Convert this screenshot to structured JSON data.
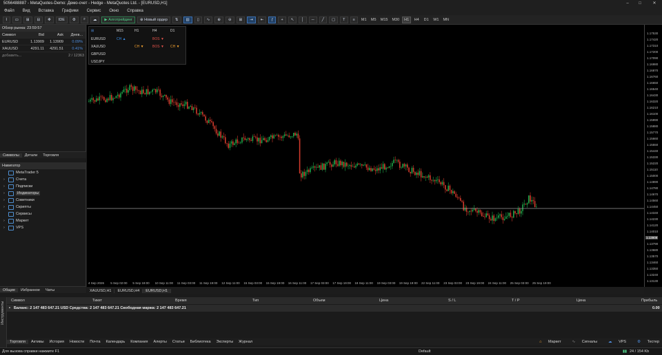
{
  "title": "5056488887 - MetaQuotes-Demo: Демо-счет - Hedge - MetaQuotes Ltd. - [EURUSD,H1]",
  "menu": [
    "Файл",
    "Вид",
    "Вставка",
    "Графики",
    "Сервис",
    "Окно",
    "Справка"
  ],
  "toolbar": {
    "algo": "Алготрейдинг",
    "new_order": "Новый ордер",
    "ide": "IDE"
  },
  "timeframes": [
    "M1",
    "M5",
    "M15",
    "M30",
    "H1",
    "H4",
    "D1",
    "W1",
    "MN"
  ],
  "market_watch": {
    "title": "Обзор рынка: 23:59:57",
    "headers": [
      "Символ",
      "Bid",
      "Ask",
      "Днев..."
    ],
    "rows": [
      {
        "symbol": "EURUSD",
        "bid": "1.13909",
        "ask": "1.13909",
        "change": "0.09%"
      },
      {
        "symbol": "XAUUSD",
        "bid": "4291.11",
        "ask": "4291.51",
        "change": "0.41%"
      }
    ],
    "add": "добавить...",
    "count": "2 / 12363",
    "tabs": [
      "Символы",
      "Детали",
      "Торговля"
    ]
  },
  "navigator": {
    "title": "Навигатор",
    "items": [
      "MetaTrader 5",
      "Счета",
      "Подписки",
      "Индикаторы",
      "Советники",
      "Скрипты",
      "Сервисы",
      "Маркет",
      "VPS"
    ],
    "tabs": [
      "Общие",
      "Избранное",
      "Чаты"
    ]
  },
  "hub": {
    "cols": [
      "M15",
      "H1",
      "H4",
      "D1"
    ],
    "rows": [
      {
        "sym": "EURUSD",
        "cells": [
          "CH ▲",
          "",
          "BOS ▼",
          ""
        ]
      },
      {
        "sym": "XAUUSD",
        "cells": [
          "",
          "CH ▼",
          "BOS ▼",
          "CH ▼"
        ]
      },
      {
        "sym": "GBPUSD",
        "cells": [
          "",
          "",
          "",
          ""
        ]
      },
      {
        "sym": "USDJPY",
        "cells": [
          "",
          "",
          "",
          ""
        ]
      }
    ]
  },
  "price_axis": [
    "1.17530",
    "1.17420",
    "1.17310",
    "1.17200",
    "1.17090",
    "1.16980",
    "1.16870",
    "1.16760",
    "1.16650",
    "1.16540",
    "1.16430",
    "1.16320",
    "1.16210",
    "1.16100",
    "1.15990",
    "1.15880",
    "1.15770",
    "1.15660",
    "1.15550",
    "1.15440",
    "1.15330",
    "1.15220",
    "1.15110",
    "1.15000",
    "1.14890",
    "1.14780",
    "1.14670",
    "1.14560",
    "1.14450",
    "1.14340",
    "1.14230",
    "1.14120",
    "1.14010",
    "1.13909",
    "1.13790",
    "1.13680",
    "1.13570",
    "1.13460",
    "1.13350",
    "1.13240",
    "1.13130"
  ],
  "current_price": "1.13909",
  "time_axis": [
    "4 Sep 2026",
    "5 Sep 02:00",
    "5 Sep 18:00",
    "10 Sep 11:00",
    "11 Sep 03:00",
    "11 Sep 19:00",
    "12 Sep 11:00",
    "15 Sep 03:00",
    "15 Sep 19:00",
    "16 Sep 11:00",
    "17 Sep 03:00",
    "17 Sep 19:00",
    "18 Sep 11:00",
    "19 Sep 03:00",
    "19 Sep 19:00",
    "22 Sep 11:00",
    "23 Sep 03:00",
    "23 Sep 19:00",
    "24 Sep 11:00",
    "25 Sep 03:00",
    "25 Sep 19:00"
  ],
  "chart_tabs": [
    "XAUUSD,H1",
    "EURUSD,H4",
    "EURUSD,H1"
  ],
  "trade": {
    "headers": [
      "Символ",
      "Тикет",
      "Время",
      "Тип",
      "Объем",
      "Цена",
      "S / L",
      "T / P",
      "Цена",
      "Прибыль"
    ],
    "balance": "Баланс: 2 147 483 647.21 USD  Средства: 2 147 483 647.21  Свободная маржа: 2 147 483 647.21",
    "profit": "0.00"
  },
  "terminal_label": "Инструменты",
  "terminal_tabs": [
    "Торговля",
    "Активы",
    "История",
    "Новости",
    "Почта",
    "Календарь",
    "Компания",
    "Алерты",
    "Статьи",
    "Библиотека",
    "Эксперты",
    "Журнал"
  ],
  "terminal_right": [
    "Маркет",
    "Сигналы",
    "VPS",
    "Тестер"
  ],
  "status": {
    "help": "Для вызова справки нажмите F1",
    "profile": "Default",
    "traffic": "24 / 154 Kb"
  },
  "colors": {
    "bull": "#1fa84a",
    "bear": "#d33a2c",
    "accent": "#3b6fb0"
  }
}
